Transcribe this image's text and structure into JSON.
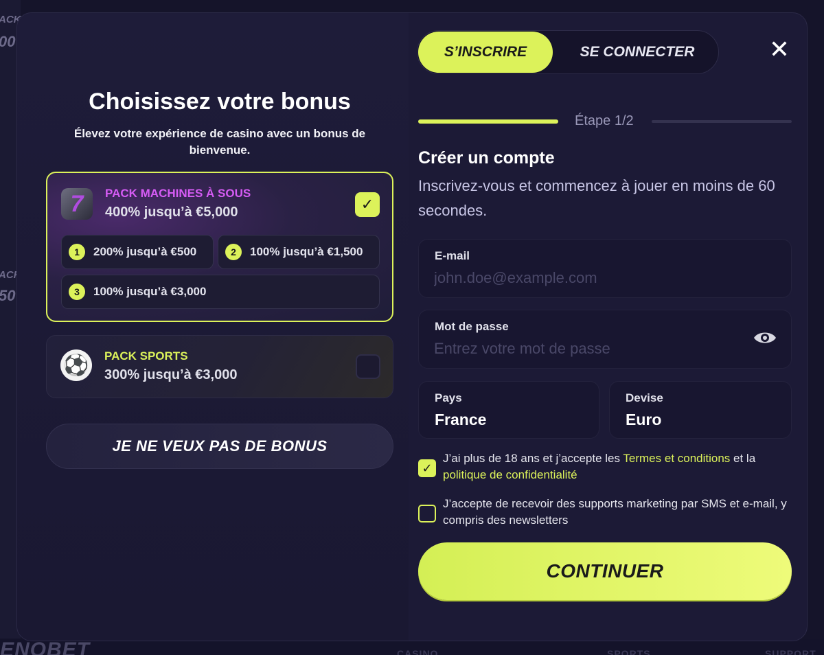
{
  "background": {
    "fragments": [
      "ACK",
      "00",
      "ACK",
      "50"
    ],
    "footer_logo": "ENOBET",
    "footer_links": [
      "CASINO",
      "SPORTS",
      "SUPPORT"
    ]
  },
  "tabs": {
    "signup": "S’INSCRIRE",
    "login": "SE CONNECTER"
  },
  "close_symbol": "✕",
  "bonus": {
    "title": "Choisissez votre bonus",
    "subtitle": "Élevez votre expérience de casino avec un bonus de bienvenue.",
    "slots_pack": {
      "name": "PACK MACHINES À SOUS",
      "amount": "400% jusqu’à €5,000",
      "icon": "slot-seven-icon",
      "checked": true,
      "tiers": [
        {
          "num": "1",
          "label": "200% jusqu’à €500"
        },
        {
          "num": "2",
          "label": "100% jusqu’à €1,500"
        },
        {
          "num": "3",
          "label": "100% jusqu’à €3,000"
        }
      ]
    },
    "sports_pack": {
      "name": "PACK SPORTS",
      "amount": "300% jusqu’à €3,000",
      "icon": "soccer-ball-icon",
      "checked": false
    },
    "no_bonus_label": "JE NE VEUX PAS DE BONUS"
  },
  "step": {
    "label": "Étape 1/2",
    "progress": 0.5
  },
  "form": {
    "title": "Créer un compte",
    "subtitle": "Inscrivez-vous et commencez à jouer en moins de 60 secondes.",
    "email": {
      "label": "E-mail",
      "placeholder": "john.doe@example.com",
      "value": ""
    },
    "password": {
      "label": "Mot de passe",
      "placeholder": "Entrez votre mot de passe",
      "value": ""
    },
    "country": {
      "label": "Pays",
      "value": "France"
    },
    "currency": {
      "label": "Devise",
      "value": "Euro"
    },
    "consent_age": {
      "checked": true,
      "text_before": "J’ai plus de 18 ans et j’accepte les ",
      "terms_link": "Termes et conditions",
      "text_middle": " et la ",
      "privacy_link": "politique de confidentialité"
    },
    "consent_marketing": {
      "checked": false,
      "text": "J’accepte de recevoir des supports marketing par SMS et e-mail, y compris des newsletters"
    },
    "continue_label": "CONTINUER"
  },
  "colors": {
    "accent": "#dcf25a",
    "slots_name": "#d65cf5",
    "background": "#1c1a36"
  }
}
